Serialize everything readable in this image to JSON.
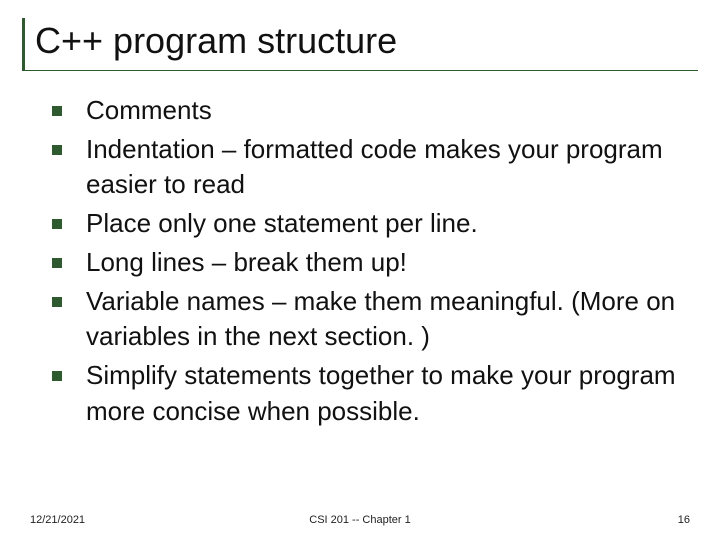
{
  "title": "C++ program structure",
  "bullets": [
    "Comments",
    "Indentation – formatted code makes your program easier to read",
    "Place only one statement per line.",
    "Long lines – break them up!",
    "Variable names – make them meaningful. (More on variables in the next section. )",
    "Simplify statements together to make your program more concise when possible."
  ],
  "footer": {
    "date": "12/21/2021",
    "center": "CSI 201 -- Chapter 1",
    "page": "16"
  }
}
